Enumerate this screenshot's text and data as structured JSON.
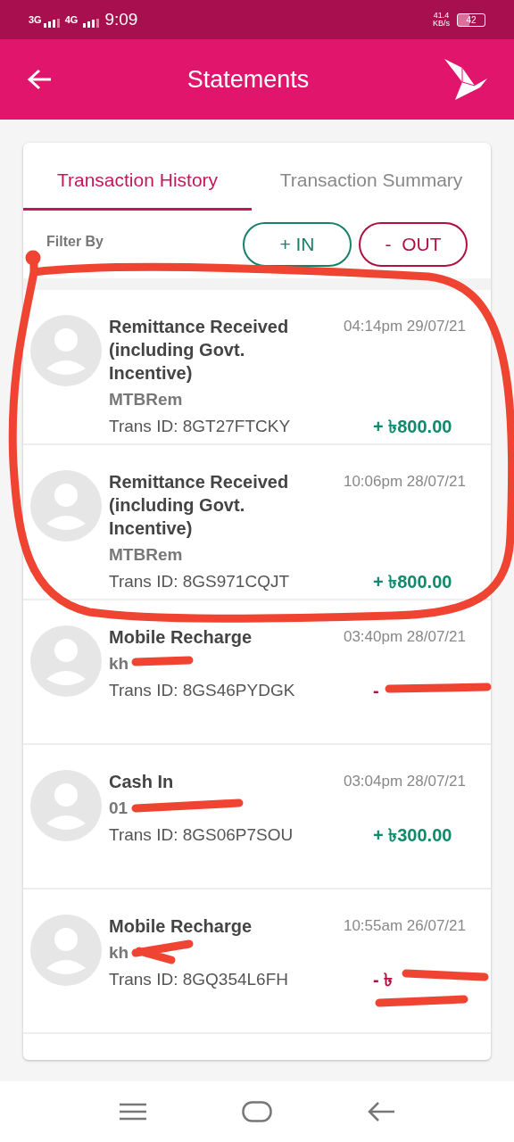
{
  "status_bar": {
    "network_1": "3G",
    "network_2": "4G",
    "time": "9:09",
    "speed": "41.4",
    "speed_unit": "KB/s",
    "battery": "42"
  },
  "header": {
    "title": "Statements"
  },
  "tabs": [
    {
      "label": "Transaction History",
      "selected": true
    },
    {
      "label": "Transaction Summary",
      "selected": false
    }
  ],
  "filter": {
    "label": "Filter By",
    "buttons": [
      {
        "label": "+ IN",
        "kind": "in"
      },
      {
        "label": "-  OUT",
        "kind": "out"
      }
    ]
  },
  "transactions": [
    {
      "title": "Remittance Received (including Govt. Incentive)",
      "party": "MTBRem",
      "trans_id": "Trans ID: 8GT27FTCKY",
      "time": "04:14pm 29/07/21",
      "amount": "+ ৳800.00",
      "kind": "in"
    },
    {
      "title": "Remittance Received (including Govt. Incentive)",
      "party": "MTBRem",
      "trans_id": "Trans ID: 8GS971CQJT",
      "time": "10:06pm 28/07/21",
      "amount": "+ ৳800.00",
      "kind": "in"
    },
    {
      "title": "Mobile Recharge",
      "party": "kh",
      "trans_id": "Trans ID: 8GS46PYDGK",
      "time": "03:40pm 28/07/21",
      "amount": "-",
      "kind": "out"
    },
    {
      "title": "Cash In",
      "party": "01",
      "trans_id": "Trans ID: 8GS06P7SOU",
      "time": "03:04pm 28/07/21",
      "amount": "+ ৳300.00",
      "kind": "in"
    },
    {
      "title": "Mobile Recharge",
      "party": "kh",
      "trans_id": "Trans ID: 8GQ354L6FH",
      "time": "10:55am 26/07/21",
      "amount": "- ৳",
      "kind": "out"
    }
  ]
}
